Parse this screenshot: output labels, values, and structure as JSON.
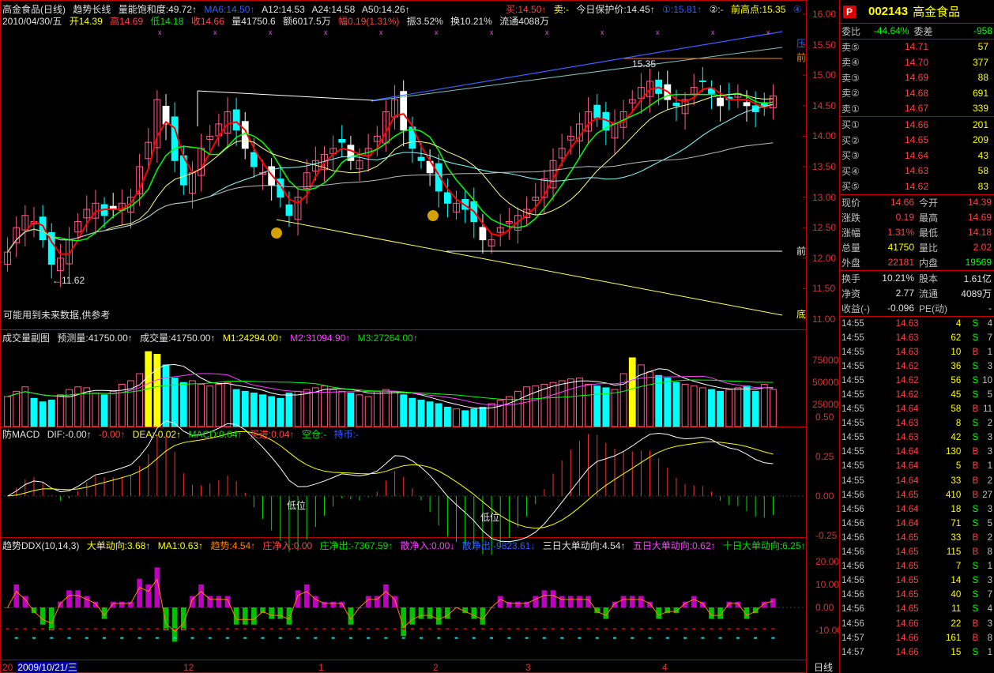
{
  "header": {
    "main_line1": [
      "高金食品(日线)",
      "趋势长线",
      "量能饱和度:49.72↑",
      "MA6:14.50↑",
      "A12:14.53",
      "A24:14.58",
      "A50:14.26↑"
    ],
    "main_line1_right": [
      "买:14.50↑",
      "卖:-",
      "今日保护价:14.45↑",
      "①:15.81↑",
      "②:-",
      "前高点:15.35",
      "④"
    ],
    "main_line2": [
      "2010/04/30/五",
      "开14.39",
      "高14.69",
      "低14.18",
      "收14.66",
      "量41750.6",
      "额6017.5万",
      "幅0.19(1.31%)",
      "振3.52%",
      "换10.21%",
      "流通4088万"
    ],
    "note": "可能用到未来数据,供参考",
    "vol_line": [
      "成交量副图",
      "预测量:41750.00↑",
      "成交量:41750.00↑",
      "M1:24294.00↑",
      "M2:31094.90↑",
      "M3:27264.00↑"
    ],
    "macd_line": [
      "防MACD",
      "DIF:-0.00↑",
      "-0.00↑",
      "DEA:-0.02↑",
      "MACD:0.04↑",
      "买进:0.04↑",
      "空仓:-",
      "持币:-"
    ],
    "ddx_line": [
      "趋势DDX(10,14,3)",
      "大单动向:3.68↑",
      "MA1:0.63↑",
      "趋势:4.54↑",
      "庄净入:0.00",
      "庄净出:-7367.59↑",
      "散净入:0.00↓",
      "散净出:-9823.61↓",
      "三日大单动向:4.54↑",
      "五日大单动向:0.62↑",
      "十日大单动向:6.25↑"
    ]
  },
  "annotations": {
    "high_mark": "15.35",
    "low_mark": "11.62",
    "low_label_1": "低位",
    "low_label_2": "低位",
    "pressure": "压",
    "front": "前",
    "front2": "前",
    "bottom": "底",
    "date_label": "2009/10/21/三",
    "months": [
      "12",
      "1",
      "2",
      "3",
      "4"
    ],
    "day_line": "日线",
    "left_tick": "20"
  },
  "price_axis": [
    "16.00",
    "15.50",
    "15.00",
    "14.50",
    "14.00",
    "13.50",
    "13.00",
    "12.50",
    "12.00",
    "11.50",
    "11.00"
  ],
  "vol_axis": [
    "75000",
    "50000",
    "25000"
  ],
  "macd_axis": [
    "0.50",
    "0.25",
    "0.00",
    "-0.25"
  ],
  "ddx_axis": [
    "20.00",
    "10.00",
    "0.00",
    "-10.00"
  ],
  "colors": {
    "up": "#ff5a8c",
    "down": "#00ffff",
    "bg": "#000000",
    "border": "#c00000"
  },
  "quote": {
    "code": "002143",
    "name": "高金食品",
    "logo": "P",
    "weibi": {
      "k": "委比",
      "v": "-44.64%",
      "k2": "委差",
      "v2": "-958"
    },
    "asks": [
      {
        "k": "卖⑤",
        "p": "14.71",
        "v": "57"
      },
      {
        "k": "卖④",
        "p": "14.70",
        "v": "377"
      },
      {
        "k": "卖③",
        "p": "14.69",
        "v": "88"
      },
      {
        "k": "卖②",
        "p": "14.68",
        "v": "691"
      },
      {
        "k": "卖①",
        "p": "14.67",
        "v": "339"
      }
    ],
    "bids": [
      {
        "k": "买①",
        "p": "14.66",
        "v": "201"
      },
      {
        "k": "买②",
        "p": "14.65",
        "v": "209"
      },
      {
        "k": "买③",
        "p": "14.64",
        "v": "43"
      },
      {
        "k": "买④",
        "p": "14.63",
        "v": "58"
      },
      {
        "k": "买⑤",
        "p": "14.62",
        "v": "83"
      }
    ],
    "summary": [
      {
        "k": "现价",
        "v1": "14.66",
        "c1": "#ff4040",
        "k2": "今开",
        "v2": "14.39",
        "c2": "#ff4040"
      },
      {
        "k": "涨跌",
        "v1": "0.19",
        "c1": "#ff4040",
        "k2": "最高",
        "v2": "14.69",
        "c2": "#ff4040"
      },
      {
        "k": "涨幅",
        "v1": "1.31%",
        "c1": "#ff4040",
        "k2": "最低",
        "v2": "14.18",
        "c2": "#ff4040"
      },
      {
        "k": "总量",
        "v1": "41750",
        "c1": "#ffff00",
        "k2": "量比",
        "v2": "2.02",
        "c2": "#ff4040"
      },
      {
        "k": "外盘",
        "v1": "22181",
        "c1": "#ff4040",
        "k2": "内盘",
        "v2": "19569",
        "c2": "#00ff00"
      }
    ],
    "summary2": [
      {
        "k": "换手",
        "v1": "10.21%",
        "k2": "股本",
        "v2": "1.61亿"
      },
      {
        "k": "净资",
        "v1": "2.77",
        "k2": "流通",
        "v2": "4089万"
      },
      {
        "k": "收益(-)",
        "v1": "-0.096",
        "k2": "PE(动)",
        "v2": "-"
      }
    ],
    "ticks": [
      {
        "t": "14:55",
        "p": "14.63",
        "v": "4",
        "d": "S",
        "c": "4"
      },
      {
        "t": "14:55",
        "p": "14.63",
        "v": "62",
        "d": "S",
        "c": "7"
      },
      {
        "t": "14:55",
        "p": "14.63",
        "v": "10",
        "d": "B",
        "c": "1"
      },
      {
        "t": "14:55",
        "p": "14.62",
        "v": "36",
        "d": "S",
        "c": "3"
      },
      {
        "t": "14:55",
        "p": "14.62",
        "v": "56",
        "d": "S",
        "c": "10"
      },
      {
        "t": "14:55",
        "p": "14.62",
        "v": "45",
        "d": "S",
        "c": "5"
      },
      {
        "t": "14:55",
        "p": "14.64",
        "v": "58",
        "d": "B",
        "c": "11"
      },
      {
        "t": "14:55",
        "p": "14.63",
        "v": "8",
        "d": "S",
        "c": "2"
      },
      {
        "t": "14:55",
        "p": "14.63",
        "v": "42",
        "d": "S",
        "c": "3"
      },
      {
        "t": "14:55",
        "p": "14.64",
        "v": "130",
        "d": "B",
        "c": "3"
      },
      {
        "t": "14:55",
        "p": "14.64",
        "v": "5",
        "d": "B",
        "c": "1"
      },
      {
        "t": "14:55",
        "p": "14.64",
        "v": "33",
        "d": "B",
        "c": "2"
      },
      {
        "t": "14:56",
        "p": "14.65",
        "v": "410",
        "d": "B",
        "c": "27"
      },
      {
        "t": "14:56",
        "p": "14.64",
        "v": "18",
        "d": "S",
        "c": "3"
      },
      {
        "t": "14:56",
        "p": "14.64",
        "v": "71",
        "d": "S",
        "c": "5"
      },
      {
        "t": "14:56",
        "p": "14.65",
        "v": "33",
        "d": "B",
        "c": "2"
      },
      {
        "t": "14:56",
        "p": "14.65",
        "v": "115",
        "d": "B",
        "c": "8"
      },
      {
        "t": "14:56",
        "p": "14.65",
        "v": "7",
        "d": "S",
        "c": "1"
      },
      {
        "t": "14:56",
        "p": "14.65",
        "v": "14",
        "d": "S",
        "c": "3"
      },
      {
        "t": "14:56",
        "p": "14.65",
        "v": "40",
        "d": "S",
        "c": "7"
      },
      {
        "t": "14:56",
        "p": "14.65",
        "v": "11",
        "d": "S",
        "c": "4"
      },
      {
        "t": "14:56",
        "p": "14.66",
        "v": "22",
        "d": "B",
        "c": "3"
      },
      {
        "t": "14:57",
        "p": "14.66",
        "v": "161",
        "d": "B",
        "c": "8"
      },
      {
        "t": "14:57",
        "p": "14.66",
        "v": "15",
        "d": "S",
        "c": "1"
      }
    ]
  },
  "chart_data": {
    "type": "candlestick",
    "last_close": 14.66,
    "price_range": [
      11.0,
      16.0
    ],
    "closes": [
      12.1,
      12.5,
      12.7,
      12.6,
      12.3,
      11.9,
      12.0,
      12.3,
      12.6,
      12.8,
      12.9,
      12.7,
      12.8,
      12.9,
      13.0,
      13.5,
      13.9,
      14.6,
      14.2,
      13.6,
      13.2,
      13.4,
      13.8,
      14.0,
      14.2,
      14.4,
      14.1,
      13.8,
      13.5,
      13.4,
      13.2,
      13.0,
      12.7,
      13.0,
      13.4,
      13.6,
      13.7,
      13.8,
      13.9,
      13.6,
      13.6,
      13.8,
      14.0,
      14.4,
      14.6,
      14.1,
      13.8,
      13.6,
      13.4,
      13.1,
      12.9,
      12.9,
      12.8,
      12.6,
      12.3,
      12.3,
      12.5,
      12.6,
      12.7,
      12.8,
      13.0,
      13.3,
      13.6,
      13.8,
      14.0,
      14.2,
      14.4,
      14.3,
      14.1,
      14.2,
      14.4,
      14.6,
      14.8,
      14.9,
      14.7,
      14.6,
      14.5,
      14.6,
      14.8,
      14.9,
      14.7,
      14.5,
      14.6,
      14.7,
      14.5,
      14.4,
      14.5,
      14.66
    ],
    "volume": [
      34,
      40,
      45,
      32,
      28,
      30,
      36,
      42,
      45,
      44,
      38,
      36,
      40,
      48,
      52,
      60,
      85,
      82,
      70,
      55,
      50,
      52,
      48,
      46,
      48,
      50,
      42,
      40,
      38,
      36,
      34,
      32,
      38,
      40,
      42,
      44,
      46,
      42,
      40,
      38,
      36,
      34,
      40,
      42,
      40,
      36,
      32,
      30,
      28,
      26,
      22,
      20,
      18,
      20,
      22,
      26,
      30,
      34,
      40,
      45,
      46,
      48,
      50,
      52,
      54,
      55,
      48,
      46,
      44,
      42,
      60,
      78,
      70,
      62,
      58,
      55,
      50,
      48,
      46,
      44,
      42,
      40,
      42,
      44,
      46,
      40,
      48,
      42
    ]
  }
}
